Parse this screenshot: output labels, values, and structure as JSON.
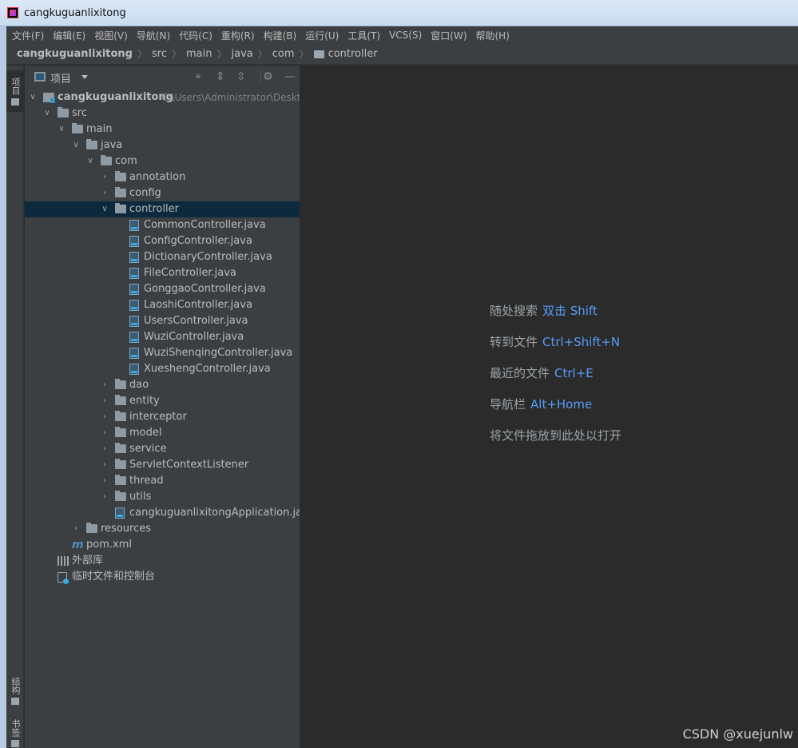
{
  "window": {
    "title": "cangkuguanlixitong"
  },
  "menubar": {
    "items": [
      "文件(F)",
      "编辑(E)",
      "视图(V)",
      "导航(N)",
      "代码(C)",
      "重构(R)",
      "构建(B)",
      "运行(U)",
      "工具(T)",
      "VCS(S)",
      "窗口(W)",
      "帮助(H)"
    ]
  },
  "breadcrumb": {
    "items": [
      "cangkuguanlixitong",
      "src",
      "main",
      "java",
      "com",
      "controller"
    ]
  },
  "toolstripe": {
    "project_tab": "项目",
    "structure_tab": "结构",
    "bookmarks_tab": "书签"
  },
  "project_panel": {
    "view_label": "项目",
    "tree": [
      {
        "label": "cangkuguanlixitong",
        "path": "C:\\Users\\Administrator\\Desktop\\",
        "icon": "module",
        "depth": 0,
        "arrow": "down",
        "bold": true
      },
      {
        "label": "src",
        "icon": "folder",
        "depth": 1,
        "arrow": "down"
      },
      {
        "label": "main",
        "icon": "folder",
        "depth": 2,
        "arrow": "down"
      },
      {
        "label": "java",
        "icon": "folder",
        "depth": 3,
        "arrow": "down"
      },
      {
        "label": "com",
        "icon": "folder",
        "depth": 4,
        "arrow": "down"
      },
      {
        "label": "annotation",
        "icon": "folder",
        "depth": 5,
        "arrow": "right"
      },
      {
        "label": "config",
        "icon": "folder",
        "depth": 5,
        "arrow": "right"
      },
      {
        "label": "controller",
        "icon": "folder",
        "depth": 5,
        "arrow": "down",
        "selected": true
      },
      {
        "label": "CommonController.java",
        "icon": "java",
        "depth": 6
      },
      {
        "label": "ConfigController.java",
        "icon": "java",
        "depth": 6
      },
      {
        "label": "DictionaryController.java",
        "icon": "java",
        "depth": 6
      },
      {
        "label": "FileController.java",
        "icon": "java",
        "depth": 6
      },
      {
        "label": "GonggaoController.java",
        "icon": "java",
        "depth": 6
      },
      {
        "label": "LaoshiController.java",
        "icon": "java",
        "depth": 6
      },
      {
        "label": "UsersController.java",
        "icon": "java",
        "depth": 6
      },
      {
        "label": "WuziController.java",
        "icon": "java",
        "depth": 6
      },
      {
        "label": "WuziShenqingController.java",
        "icon": "java",
        "depth": 6
      },
      {
        "label": "XueshengController.java",
        "icon": "java",
        "depth": 6
      },
      {
        "label": "dao",
        "icon": "folder",
        "depth": 5,
        "arrow": "right"
      },
      {
        "label": "entity",
        "icon": "folder",
        "depth": 5,
        "arrow": "right"
      },
      {
        "label": "interceptor",
        "icon": "folder",
        "depth": 5,
        "arrow": "right"
      },
      {
        "label": "model",
        "icon": "folder",
        "depth": 5,
        "arrow": "right"
      },
      {
        "label": "service",
        "icon": "folder",
        "depth": 5,
        "arrow": "right"
      },
      {
        "label": "ServletContextListener",
        "icon": "folder",
        "depth": 5,
        "arrow": "right"
      },
      {
        "label": "thread",
        "icon": "folder",
        "depth": 5,
        "arrow": "right"
      },
      {
        "label": "utils",
        "icon": "folder",
        "depth": 5,
        "arrow": "right"
      },
      {
        "label": "cangkuguanlixitongApplication.java",
        "icon": "java",
        "depth": 5
      },
      {
        "label": "resources",
        "icon": "folder",
        "depth": 3,
        "arrow": "right"
      },
      {
        "label": "pom.xml",
        "icon": "maven",
        "depth": 2
      },
      {
        "label": "外部库",
        "icon": "library",
        "depth": 1
      },
      {
        "label": "临时文件和控制台",
        "icon": "scratch",
        "depth": 1
      }
    ]
  },
  "editor": {
    "hints": [
      {
        "text": "随处搜索",
        "key": "双击 Shift"
      },
      {
        "text": "转到文件",
        "key": "Ctrl+Shift+N"
      },
      {
        "text": "最近的文件",
        "key": "Ctrl+E"
      },
      {
        "text": "导航栏",
        "key": "Alt+Home"
      },
      {
        "text": "将文件拖放到此处以打开",
        "key": ""
      }
    ]
  },
  "watermark": "CSDN @xuejunlw"
}
